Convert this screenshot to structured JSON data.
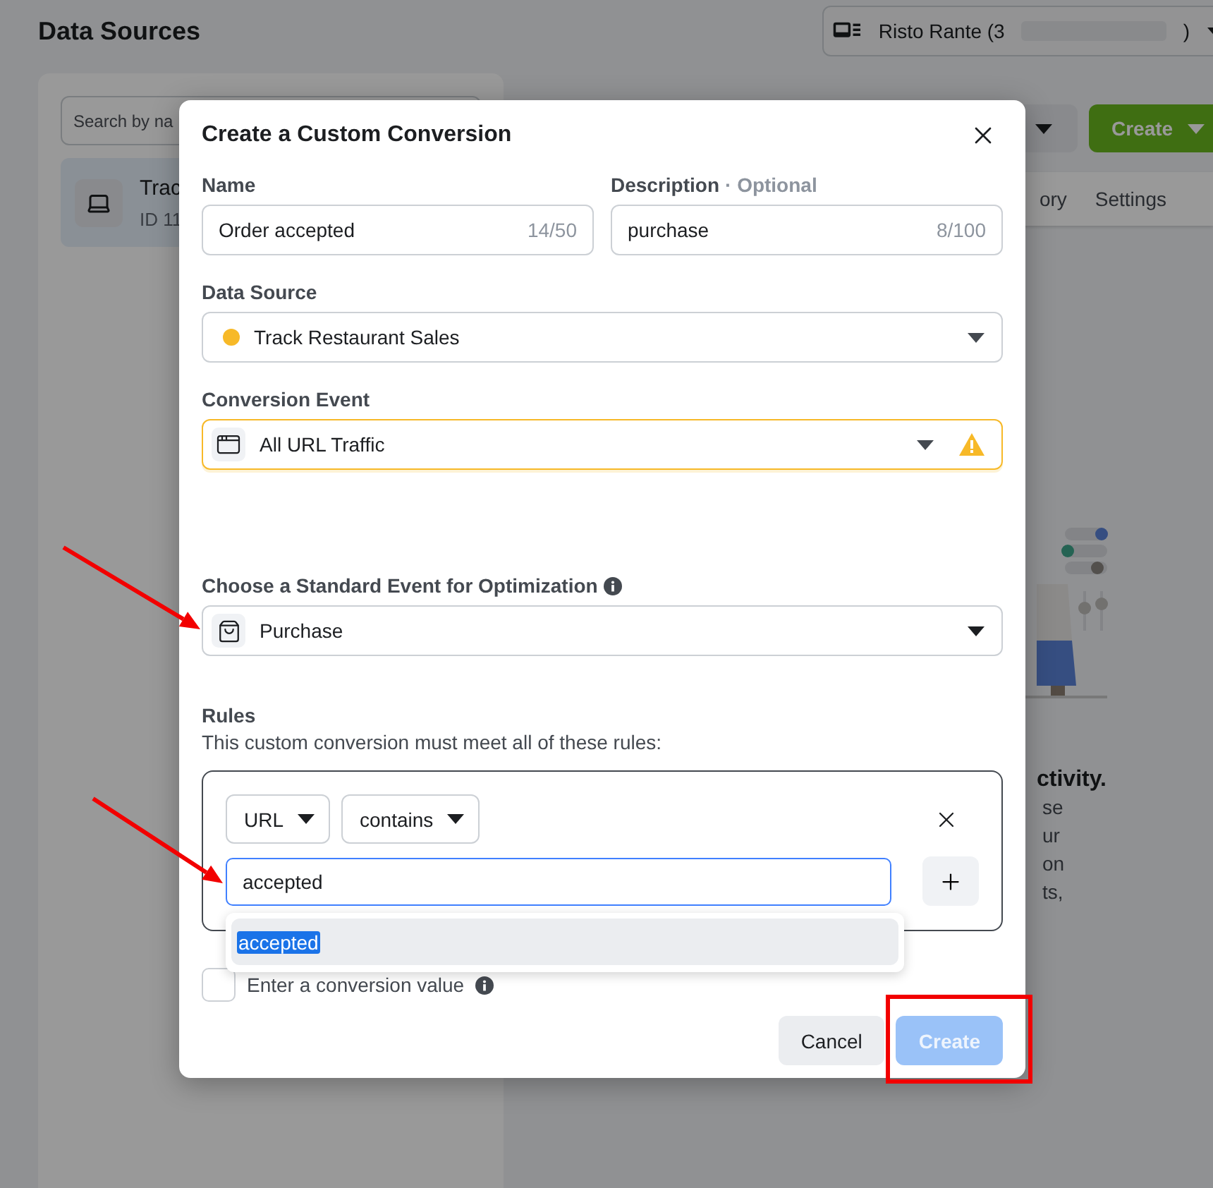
{
  "page": {
    "title": "Data Sources"
  },
  "account_selector": {
    "name": "Risto Rante (3",
    "suffix": ")"
  },
  "sidebar": {
    "search": {
      "placeholder": "Search by na"
    },
    "items": [
      {
        "name": "Trac",
        "id": "ID 11",
        "selected": true
      }
    ]
  },
  "toolbar": {
    "create_button": "Create"
  },
  "tabs": [
    {
      "label": "ory"
    },
    {
      "label": "Settings"
    }
  ],
  "empty_state": {
    "heading": "ctivity.",
    "lines": [
      "se",
      "ur",
      "on",
      "ts,"
    ]
  },
  "dialog": {
    "title": "Create a Custom Conversion",
    "name": {
      "label": "Name",
      "value": "Order accepted",
      "counter": "14/50"
    },
    "description": {
      "label": "Description",
      "optional": "· Optional",
      "value": "purchase",
      "counter": "8/100"
    },
    "data_source": {
      "label": "Data Source",
      "value": "Track Restaurant Sales"
    },
    "conversion_event": {
      "label": "Conversion Event",
      "value": "All URL Traffic",
      "warning": true
    },
    "standard_event": {
      "label": "Choose a Standard Event for Optimization",
      "value": "Purchase"
    },
    "rules": {
      "title": "Rules",
      "subtitle": "This custom conversion must meet all of these rules:",
      "field": "URL",
      "operator": "contains",
      "value": "accepted",
      "suggestions": [
        {
          "text": "accepted",
          "selected": true
        }
      ]
    },
    "conversion_value": {
      "label": "Enter a conversion value",
      "checked": false
    },
    "buttons": [
      {
        "label": "Cancel",
        "kind": "secondary",
        "disabled": false
      },
      {
        "label": "Create",
        "kind": "primary",
        "disabled": true
      }
    ]
  },
  "annotations": [
    {
      "kind": "arrow"
    },
    {
      "kind": "arrow"
    },
    {
      "kind": "frame"
    }
  ]
}
